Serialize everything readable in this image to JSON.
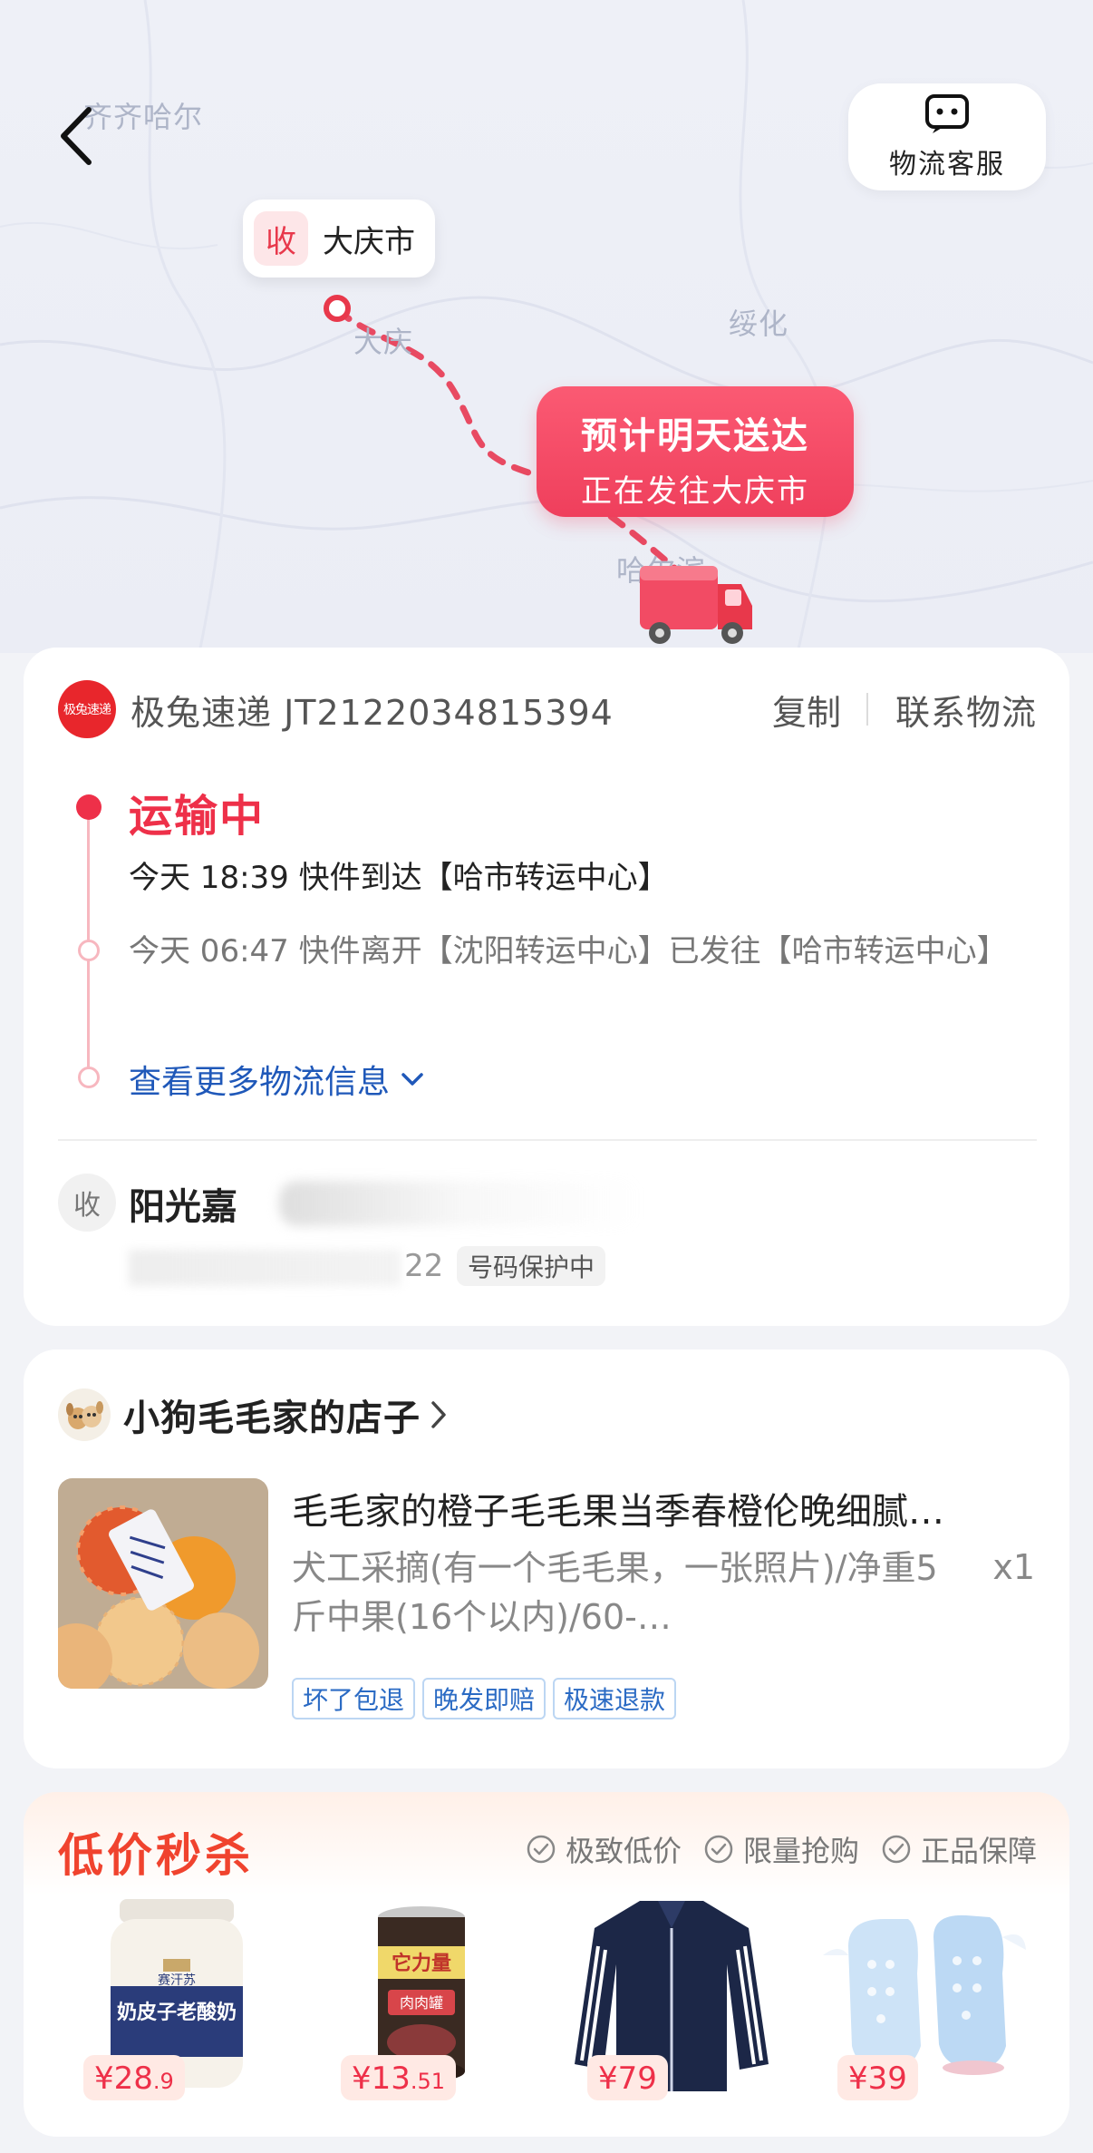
{
  "map": {
    "cities": [
      "齐齐哈尔",
      "大庆",
      "绥化",
      "哈尔滨"
    ],
    "back_icon": "chevron-left-icon",
    "service_button": {
      "label": "物流客服",
      "icon": "headset-icon"
    },
    "destination": {
      "tag": "收",
      "city": "大庆市"
    },
    "eta": {
      "line1": "预计明天送达",
      "line2": "正在发往大庆市"
    }
  },
  "logistics": {
    "courier_logo_text": "极兔速递",
    "courier": "极兔速递 JT2122034815394",
    "copy_label": "复制",
    "contact_label": "联系物流",
    "status": "运输中",
    "events": [
      "今天 18:39 快件到达【哈市转运中心】",
      "今天 06:47 快件离开【沈阳转运中心】已发往【哈市转运中心】"
    ],
    "more_label": "查看更多物流信息",
    "recipient": {
      "tag": "收",
      "name": "阳光嘉",
      "phone": "22",
      "privacy_badge": "号码保护中"
    }
  },
  "shop": {
    "name": "小狗毛毛家的店子",
    "product": {
      "title": "毛毛家的橙子毛毛果当季春橙伦晚细腻…",
      "spec": "犬工采摘(有一个毛毛果，一张照片)/净重5斤中果(16个以内)/60-…",
      "qty": "x1"
    },
    "badges": [
      "坏了包退",
      "晚发即赔",
      "极速退款"
    ]
  },
  "flash_sale": {
    "title": "低价秒杀",
    "perks": [
      "极致低价",
      "限量抢购",
      "正品保障"
    ],
    "items": [
      {
        "price_main": "¥28",
        "price_dec": ".9",
        "label": "奶皮子老酸奶",
        "brand": "赛汗苏"
      },
      {
        "price_main": "¥13",
        "price_dec": ".51",
        "label": "肉肉罐",
        "brand": "它力量"
      },
      {
        "price_main": "¥79",
        "price_dec": ""
      },
      {
        "price_main": "¥39",
        "price_dec": ""
      }
    ]
  },
  "colors": {
    "accent_red": "#ee3049",
    "link_blue": "#1f58b9",
    "flash_orange": "#f0432e"
  }
}
